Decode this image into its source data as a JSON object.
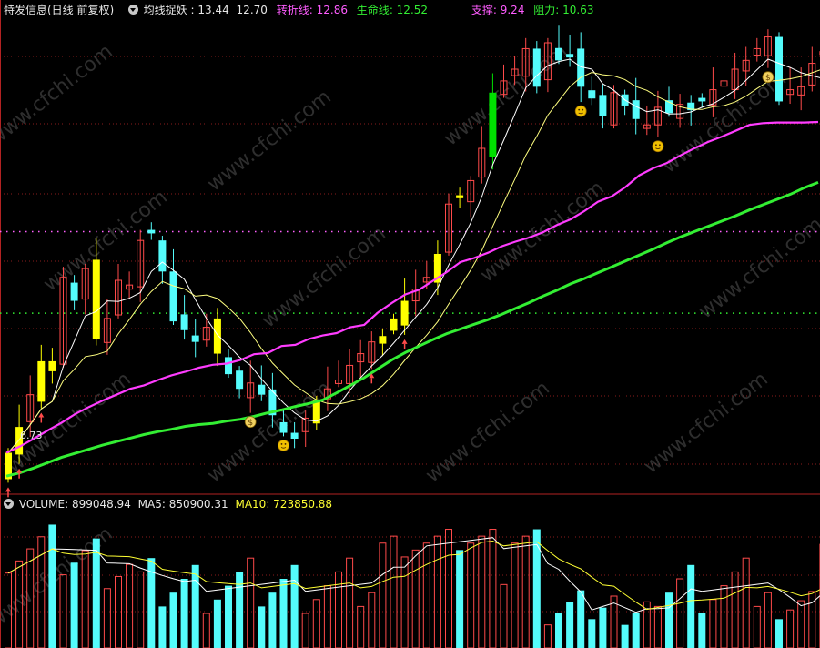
{
  "colors": {
    "up": "#ff4a4a",
    "down": "#54fcfc",
    "signal": "#ffff00",
    "signal_green": "#00e000",
    "turn": "#ff3cff",
    "life": "#33ee33",
    "ma_a": "#ffffff",
    "ma_b": "#ffff80",
    "support": "#33ee33",
    "resistance": "#ff60ff",
    "grid": "#8a1c1c",
    "header_white": "#e8e8e8",
    "header_pink": "#ff5cff",
    "header_green": "#33ee33",
    "header_yellow": "#ffff33"
  },
  "header": {
    "title": "特发信息(日线 前复权)",
    "indicator_name": "均线捉妖",
    "sep": " : ",
    "val1": "13.44",
    "val2": "12.70",
    "turn_label": "转折线",
    "turn_value": "12.86",
    "life_label": "生命线",
    "life_value": "12.52",
    "support_label": "支撑",
    "support_value": "9.24",
    "resist_label": "阻力",
    "resist_value": "10.63"
  },
  "volume_header": {
    "label": "VOLUME",
    "value": "899048.94",
    "ma5_label": "MA5",
    "ma5_value": "850900.31",
    "ma10_label": "MA10",
    "ma10_value": "723850.88"
  },
  "price_annotation": "6.73",
  "watermark": "www.cfchi.com",
  "chart_data": {
    "type": "candlestick",
    "price_range": [
      6.2,
      14.3
    ],
    "support": 9.24,
    "resistance": 10.63,
    "lines": {
      "turn_line": [
        6.86,
        6.97,
        7.1,
        7.24,
        7.37,
        7.52,
        7.64,
        7.75,
        7.85,
        7.95,
        8.01,
        8.1,
        8.18,
        8.24,
        8.31,
        8.36,
        8.38,
        8.44,
        8.54,
        8.56,
        8.68,
        8.7,
        8.8,
        8.86,
        8.9,
        9.0,
        9.04,
        9.25,
        9.41,
        9.56,
        9.64,
        9.79,
        9.94,
        10.11,
        10.18,
        10.27,
        10.38,
        10.46,
        10.53,
        10.62,
        10.74,
        10.84,
        10.98,
        11.14,
        11.23,
        11.39,
        11.59,
        11.71,
        11.8,
        11.93,
        12.05,
        12.16,
        12.25,
        12.35,
        12.45,
        12.48,
        12.49,
        12.49,
        12.49,
        12.5
      ],
      "life_line": [
        6.46,
        6.52,
        6.6,
        6.69,
        6.78,
        6.85,
        6.92,
        6.99,
        7.05,
        7.11,
        7.17,
        7.22,
        7.26,
        7.31,
        7.34,
        7.36,
        7.4,
        7.43,
        7.48,
        7.54,
        7.59,
        7.65,
        7.7,
        7.76,
        7.88,
        8.01,
        8.14,
        8.29,
        8.44,
        8.57,
        8.68,
        8.79,
        8.89,
        8.97,
        9.05,
        9.13,
        9.22,
        9.32,
        9.42,
        9.53,
        9.63,
        9.74,
        9.83,
        9.93,
        10.03,
        10.13,
        10.23,
        10.33,
        10.44,
        10.54,
        10.63,
        10.72,
        10.81,
        10.9,
        11.0,
        11.09,
        11.18,
        11.27,
        11.38,
        11.47
      ]
    },
    "volume": {
      "range": [
        0,
        1200000
      ],
      "ma5_value": 850900.31,
      "ma10_value": 723850.88,
      "last_value": 899048.94
    }
  }
}
